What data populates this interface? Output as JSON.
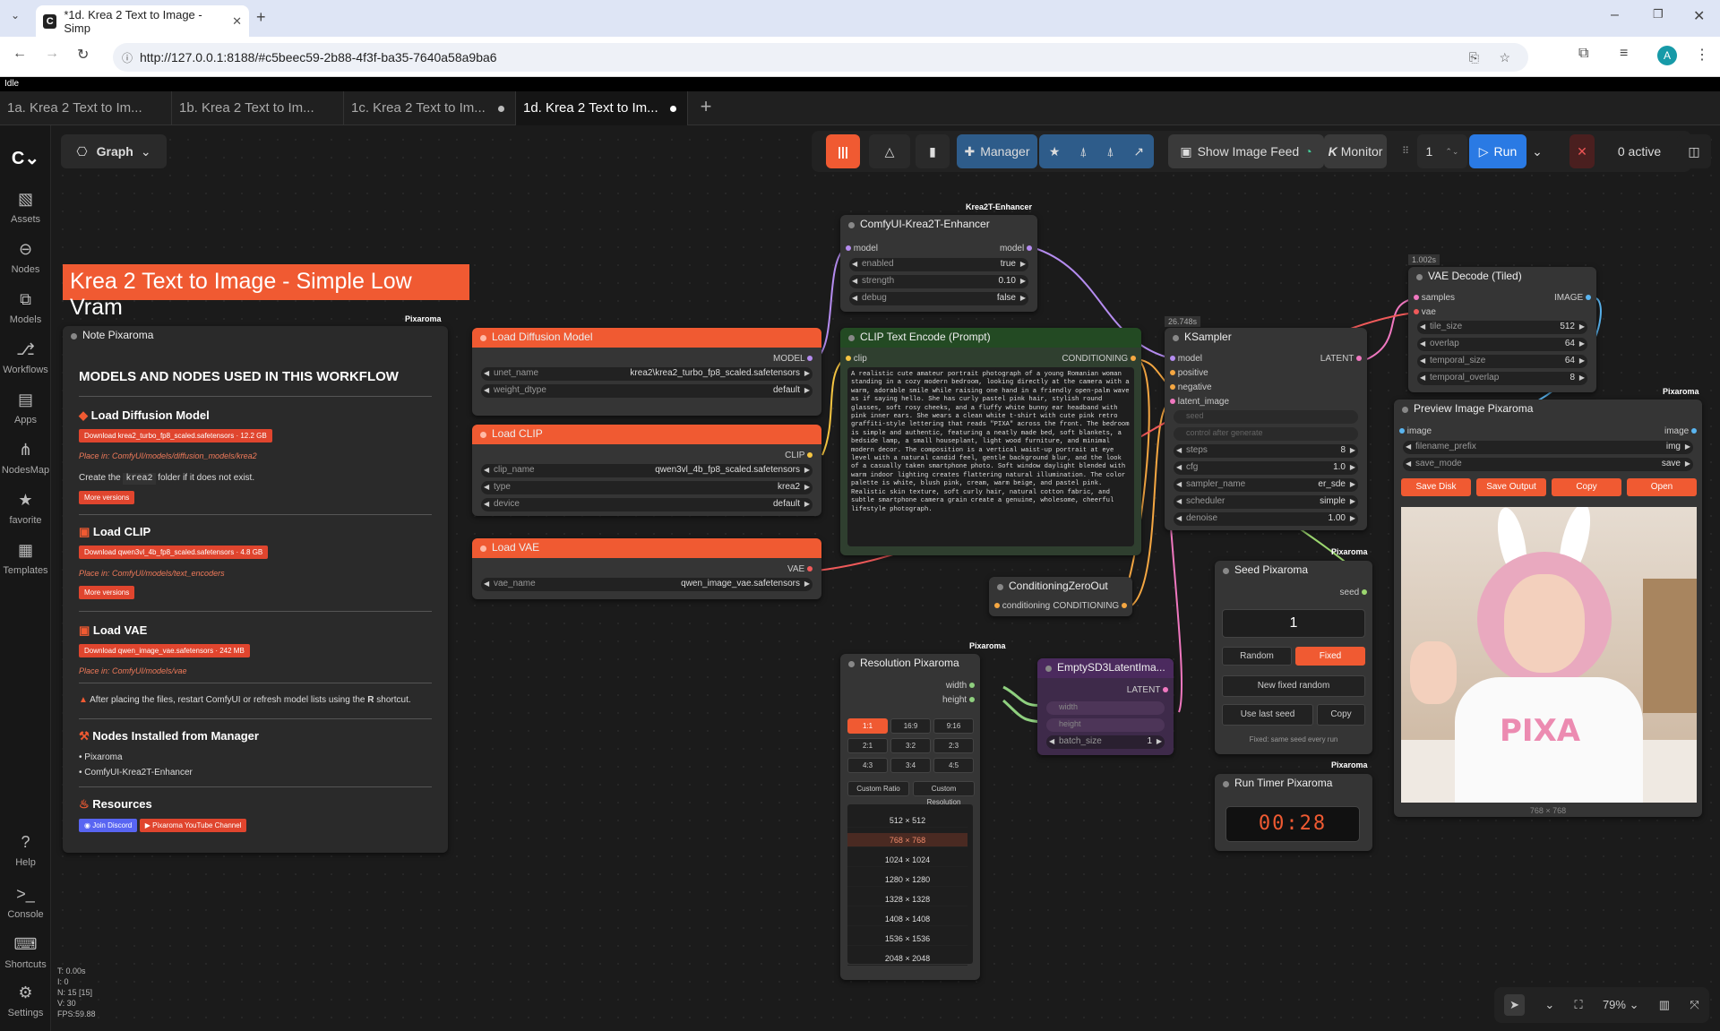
{
  "browser": {
    "tab_title": "*1d. Krea 2 Text to Image - Simp",
    "url": "http://127.0.0.1:8188/#c5beec59-2b88-4f3f-ba35-7640a58a9ba6",
    "profile_initial": "A"
  },
  "status_line": "Idle",
  "workflow_tabs": [
    "1a. Krea 2 Text to Im...",
    "1b. Krea 2 Text to Im...",
    "1c. Krea 2 Text to Im...",
    "1d. Krea 2 Text to Im..."
  ],
  "sidebar": [
    {
      "label": "Assets"
    },
    {
      "label": "Nodes"
    },
    {
      "label": "Models"
    },
    {
      "label": "Workflows"
    },
    {
      "label": "Apps"
    },
    {
      "label": "NodesMap"
    },
    {
      "label": "favorite"
    },
    {
      "label": "Templates"
    },
    {
      "label": "Help"
    },
    {
      "label": "Console"
    },
    {
      "label": "Shortcuts"
    },
    {
      "label": "Settings"
    }
  ],
  "toolbar": {
    "graph": "Graph",
    "manager": "Manager",
    "show_image_feed": "Show Image Feed",
    "monitor": "Monitor",
    "queue_count": "1",
    "run": "Run",
    "active": "0 active"
  },
  "title_banner": "Krea 2 Text to Image - Simple Low Vram",
  "tags": {
    "pixaroma": "Pixaroma",
    "krea2t": "Krea2T-Enhancer"
  },
  "note": {
    "title": "Note Pixaroma",
    "heading": "MODELS AND NODES USED IN THIS WORKFLOW",
    "s1_title": "Load Diffusion Model",
    "s1_dl": "Download krea2_turbo_fp8_scaled.safetensors",
    "s1_size": "12.2 GB",
    "s1_place": "Place in: ComfyUI/models/diffusion_models/krea2",
    "s1_create_a": "Create the",
    "s1_create_code": "krea2",
    "s1_create_b": "folder if it does not exist.",
    "more": "More versions",
    "s2_title": "Load CLIP",
    "s2_dl": "Download qwen3vl_4b_fp8_scaled.safetensors",
    "s2_size": "4.8 GB",
    "s2_place": "Place in: ComfyUI/models/text_encoders",
    "s3_title": "Load VAE",
    "s3_dl": "Download qwen_image_vae.safetensors",
    "s3_size": "242 MB",
    "s3_place": "Place in: ComfyUI/models/vae",
    "warn_a": "After placing the files, restart ComfyUI or refresh model lists using the",
    "warn_key": "R",
    "warn_b": "shortcut.",
    "nodes_title": "Nodes Installed from Manager",
    "nodes": [
      "Pixaroma",
      "ComfyUI-Krea2T-Enhancer"
    ],
    "res_title": "Resources",
    "discord": "Join Discord",
    "youtube": "Pixaroma YouTube Channel"
  },
  "load_diffusion": {
    "title": "Load Diffusion Model",
    "out": "MODEL",
    "unet_name_k": "unet_name",
    "unet_name": "krea2\\krea2_turbo_fp8_scaled.safetensors",
    "weight_dtype_k": "weight_dtype",
    "weight_dtype": "default"
  },
  "load_clip": {
    "title": "Load CLIP",
    "out": "CLIP",
    "clip_name_k": "clip_name",
    "clip_name": "qwen3vl_4b_fp8_scaled.safetensors",
    "type_k": "type",
    "type": "krea2",
    "device_k": "device",
    "device": "default"
  },
  "load_vae": {
    "title": "Load VAE",
    "out": "VAE",
    "vae_name_k": "vae_name",
    "vae_name": "qwen_image_vae.safetensors"
  },
  "enhancer": {
    "title": "ComfyUI-Krea2T-Enhancer",
    "in": "model",
    "out": "model",
    "enabled_k": "enabled",
    "enabled": "true",
    "strength_k": "strength",
    "strength": "0.10",
    "debug_k": "debug",
    "debug": "false"
  },
  "clip_encode": {
    "title": "CLIP Text Encode (Prompt)",
    "in": "clip",
    "out": "CONDITIONING",
    "text": "A realistic cute amateur portrait photograph of a young Romanian woman standing in a cozy modern bedroom, looking directly at the camera with a warm, adorable smile while raising one hand in a friendly open-palm wave as if saying hello. She has curly pastel pink hair, stylish round glasses, soft rosy cheeks, and a fluffy white bunny ear headband with pink inner ears. She wears a clean white t-shirt with cute pink retro graffiti-style lettering that reads \"PIXA\" across the front. The bedroom is simple and authentic, featuring a neatly made bed, soft blankets, a bedside lamp, a small houseplant, light wood furniture, and minimal modern decor. The composition is a vertical waist-up portrait at eye level with a natural candid feel, gentle background blur, and the look of a casually taken smartphone photo. Soft window daylight blended with warm indoor lighting creates flattering natural illumination. The color palette is white, blush pink, cream, warm beige, and pastel pink. Realistic skin texture, soft curly hair, natural cotton fabric, and subtle smartphone camera grain create a genuine, wholesome, cheerful lifestyle photograph."
  },
  "ksampler": {
    "time": "26.748s",
    "title": "KSampler",
    "in": [
      "model",
      "positive",
      "negative",
      "latent_image"
    ],
    "out": "LATENT",
    "seed_k": "seed",
    "control": "control after generate",
    "steps_k": "steps",
    "steps": "8",
    "cfg_k": "cfg",
    "cfg": "1.0",
    "sampler_k": "sampler_name",
    "sampler": "er_sde",
    "scheduler_k": "scheduler",
    "scheduler": "simple",
    "denoise_k": "denoise",
    "denoise": "1.00"
  },
  "vae_decode": {
    "time": "1.002s",
    "title": "VAE Decode (Tiled)",
    "in": [
      "samples",
      "vae"
    ],
    "out": "IMAGE",
    "tile_size_k": "tile_size",
    "tile_size": "512",
    "overlap_k": "overlap",
    "overlap": "64",
    "temporal_size_k": "temporal_size",
    "temporal_size": "64",
    "temporal_overlap_k": "temporal_overlap",
    "temporal_overlap": "8"
  },
  "preview": {
    "title": "Preview Image Pixaroma",
    "in": "image",
    "out": "image",
    "prefix_k": "filename_prefix",
    "prefix": "img",
    "save_mode_k": "save_mode",
    "save_mode": "save",
    "buttons": [
      "Save Disk",
      "Save Output",
      "Copy",
      "Open"
    ],
    "size": "768 × 768",
    "shirt_text": "PIXA"
  },
  "seed": {
    "title": "Seed Pixaroma",
    "out": "seed",
    "value": "1",
    "random": "Random",
    "fixed": "Fixed",
    "new_fixed": "New fixed random",
    "use_last": "Use last seed",
    "copy": "Copy",
    "hint": "Fixed: same seed every run"
  },
  "timer": {
    "title": "Run Timer Pixaroma",
    "value": "00:28"
  },
  "czo": {
    "title": "ConditioningZeroOut",
    "in": "conditioning",
    "out": "CONDITIONING"
  },
  "resolution": {
    "title": "Resolution Pixaroma",
    "out": [
      "width",
      "height"
    ],
    "ratios": [
      "1:1",
      "16:9",
      "9:16",
      "2:1",
      "3:2",
      "2:3",
      "4:3",
      "3:4",
      "4:5"
    ],
    "custom_ratio": "Custom Ratio",
    "custom_res": "Custom Resolution",
    "sizes": [
      "512 × 512",
      "768 × 768",
      "1024 × 1024",
      "1280 × 1280",
      "1328 × 1328",
      "1408 × 1408",
      "1536 × 1536",
      "2048 × 2048"
    ]
  },
  "latent": {
    "title": "EmptySD3LatentIma...",
    "out": "LATENT",
    "width_k": "width",
    "height_k": "height",
    "batch_k": "batch_size",
    "batch": "1"
  },
  "stats": {
    "t": "T: 0.00s",
    "i": "I: 0",
    "n": "N: 15 [15]",
    "v": "V: 30",
    "fps": "FPS:59.88"
  },
  "zoom": "79%",
  "colors": {
    "orange": "#f05a32",
    "run_blue": "#2a7ae4",
    "manager_blue": "#2e5c8a"
  }
}
